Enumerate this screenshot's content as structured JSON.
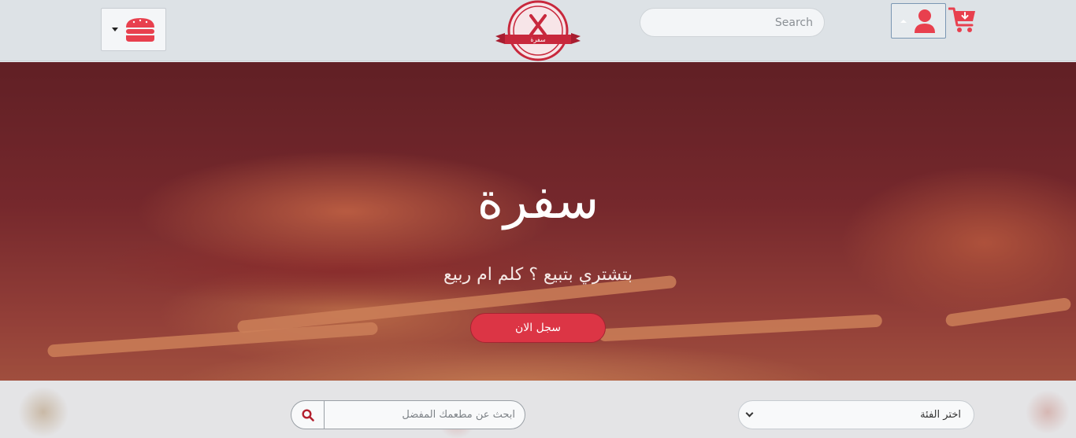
{
  "header": {
    "search_placeholder": "Search",
    "logo_text": "سفرة",
    "menu_icon": "burger-icon",
    "user_icon": "user-icon",
    "cart_icon": "cart-icon"
  },
  "hero": {
    "title": "سفرة",
    "subtitle": "بتشتري بتبيع ؟ كلم ام ربيع",
    "cta_label": "سجل الان"
  },
  "filters": {
    "restaurant_search_placeholder": "ابحث عن مطعمك المفضل",
    "category_select_label": "اختر الفئة"
  },
  "colors": {
    "accent": "#dc3545",
    "header_bg": "#dde2e6"
  }
}
